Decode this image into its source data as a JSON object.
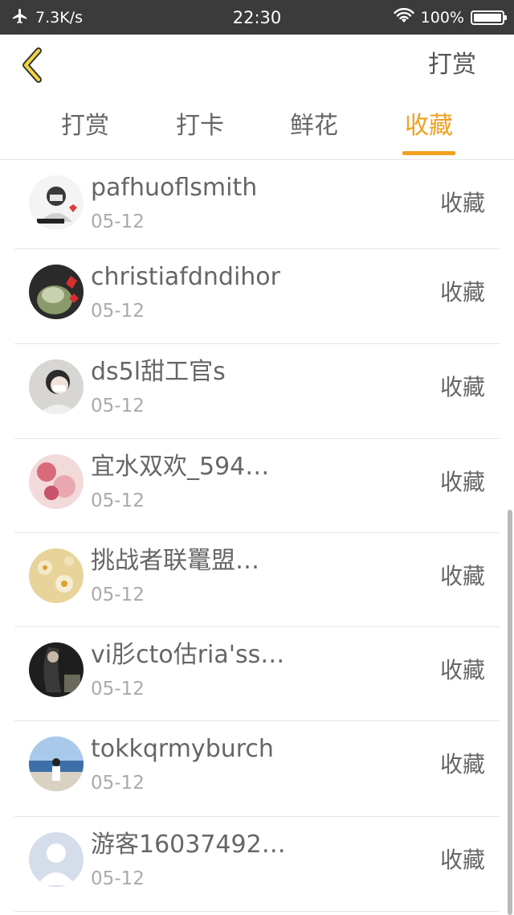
{
  "status_bar": {
    "speed": "7.3K/s",
    "time": "22:30",
    "battery": "100%",
    "icons": [
      "airplane-icon",
      "wifi-icon",
      "battery-icon"
    ]
  },
  "header": {
    "back_icon": "chevron-left-icon",
    "action_label": "打赏"
  },
  "tabs": [
    {
      "label": "打赏",
      "active": false
    },
    {
      "label": "打卡",
      "active": false
    },
    {
      "label": "鲜花",
      "active": false
    },
    {
      "label": "收藏",
      "active": true
    }
  ],
  "colors": {
    "accent": "#f0a020",
    "status_bar": "#3b3b3b"
  },
  "list": [
    {
      "name": "pafhuoflsmith",
      "date": "05-12",
      "action": "收藏"
    },
    {
      "name": "christiafdndihor",
      "date": "05-12",
      "action": "收藏"
    },
    {
      "name": "ds5l甜工官s",
      "date": "05-12",
      "action": "收藏"
    },
    {
      "name": "宜水双欢_594…",
      "date": "05-12",
      "action": "收藏"
    },
    {
      "name": "挑战者联鼍盟…",
      "date": "05-12",
      "action": "收藏"
    },
    {
      "name": "vi肜cto估ria'ss…",
      "date": "05-12",
      "action": "收藏"
    },
    {
      "name": "tokkqrmyburch",
      "date": "05-12",
      "action": "收藏"
    },
    {
      "name": "游客16037492…",
      "date": "05-12",
      "action": "收藏"
    }
  ]
}
